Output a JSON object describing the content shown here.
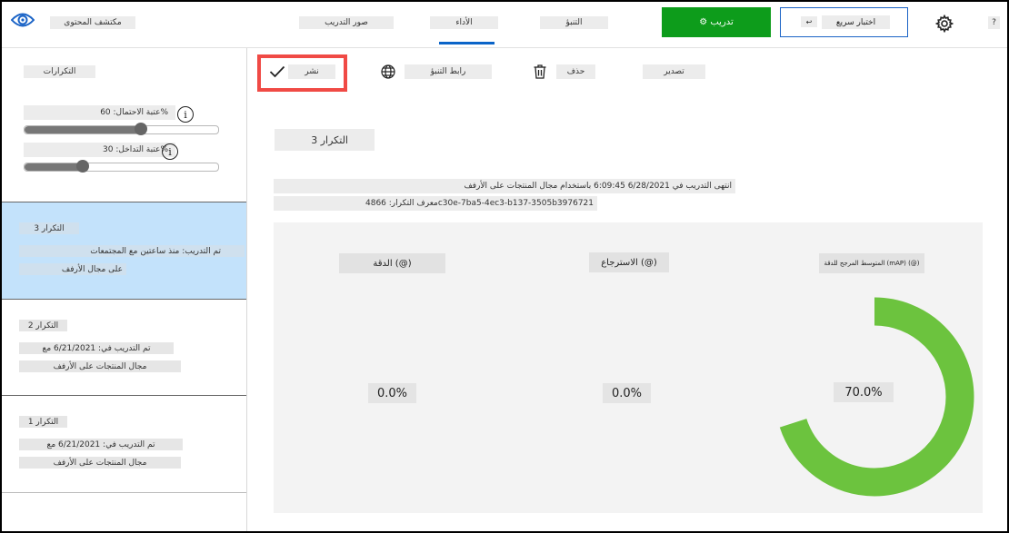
{
  "header": {
    "project_name": "مكتشف المحتوى",
    "tabs": [
      {
        "label": "صور التدريب"
      },
      {
        "label": "الأداء"
      },
      {
        "label": "التنبؤ"
      }
    ],
    "train_button": "⚙ تدريب",
    "quick_test": {
      "label": "اختبار سريع",
      "arrow": "↩"
    },
    "help": "?"
  },
  "sidebar": {
    "title": "التكرارات",
    "probability_threshold": {
      "label": "عتبة الاحتمال: 60%",
      "value_percent": 60
    },
    "overlap_threshold": {
      "label": "عتبة التداخل: 30%",
      "value_percent": 30
    },
    "iterations": [
      {
        "name": "التكرار 3",
        "trained": "تم التدريب: منذ ساعتين مع المجتمعات",
        "domain": "على مجال الأرفف",
        "selected": true
      },
      {
        "name": "التكرار 2",
        "trained": "تم التدريب في: 6/21/2021 مع",
        "domain": "مجال المنتجات على الأرفف",
        "selected": false
      },
      {
        "name": "التكرار 1",
        "trained": "تم التدريب في: 6/21/2021 مع",
        "domain": "مجال المنتجات على الأرفف",
        "selected": false
      }
    ]
  },
  "toolbar": {
    "publish": "نشر",
    "prediction_url": "رابط التنبؤ",
    "delete": "حذف",
    "export": "تصدير"
  },
  "iteration": {
    "title": "التكرار 3",
    "finished_text": "انتهى التدريب في 6/28/2021 6:09:45 باستخدام مجال المنتجات على الأرفف",
    "id_text": "معرف التكرار: 4866c30e-7ba5-4ec3-b137-3505b3976721"
  },
  "metrics": {
    "precision": {
      "label": "الدقة (@)",
      "value": "0.0%",
      "fraction": 0.0
    },
    "recall": {
      "label": "الاسترجاع (@)",
      "value": "0.0%",
      "fraction": 0.0
    },
    "map": {
      "label": "المتوسط المرجح للدقة (mAP) (@)",
      "value": "70.0%",
      "fraction": 0.7
    }
  },
  "colors": {
    "train_button": "#0d9c1b",
    "accent": "#0a64c8",
    "selected_item": "#c3e2fb",
    "donut_fill": "#6cc33e",
    "highlight": "#f04a45"
  },
  "icons": {
    "logo": "eye-icon",
    "settings": "gear-icon",
    "publish": "checkmark-icon",
    "prediction_url": "globe-icon",
    "delete": "trash-icon",
    "info": "info-icon"
  }
}
